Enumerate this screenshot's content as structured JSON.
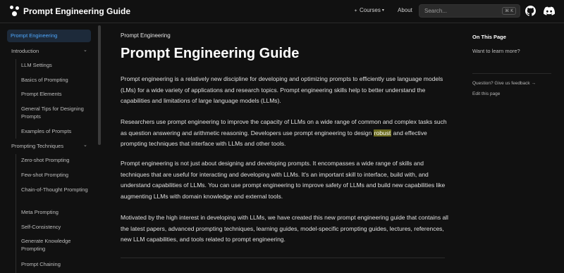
{
  "navbar": {
    "brand": "Prompt Engineering Guide",
    "courses": "Courses",
    "about": "About",
    "search_placeholder": "Search...",
    "search_shortcut": "⌘ K"
  },
  "sidebar": {
    "active": "Prompt Engineering",
    "introduction": "Introduction",
    "intro_items": [
      "LLM Settings",
      "Basics of Prompting",
      "Prompt Elements",
      "General Tips for Designing Prompts",
      "Examples of Prompts"
    ],
    "techniques": "Prompting Techniques",
    "technique_items": [
      "Zero-shot Prompting",
      "Few-shot Prompting",
      "Chain-of-Thought Prompting",
      "Meta Prompting",
      "Self-Consistency",
      "Generate Knowledge Prompting",
      "Prompt Chaining"
    ]
  },
  "main": {
    "breadcrumb": "Prompt Engineering",
    "title": "Prompt Engineering Guide",
    "p1": "Prompt engineering is a relatively new discipline for developing and optimizing prompts to efficiently use language models (LMs) for a wide variety of applications and research topics. Prompt engineering skills help to better understand the capabilities and limitations of large language models (LLMs).",
    "p2_before": "Researchers use prompt engineering to improve the capacity of LLMs on a wide range of common and complex tasks such as question answering and arithmetic reasoning. Developers use prompt engineering to design ",
    "p2_highlight": "robust",
    "p2_after": " and effective prompting techniques that interface with LLMs and other tools.",
    "p3": "Prompt engineering is not just about designing and developing prompts. It encompasses a wide range of skills and techniques that are useful for interacting and developing with LLMs. It's an important skill to interface, build with, and understand capabilities of LLMs. You can use prompt engineering to improve safety of LLMs and build new capabilities like augmenting LLMs with domain knowledge and external tools.",
    "p4": "Motivated by the high interest in developing with LLMs, we have created this new prompt engineering guide that contains all the latest papers, advanced prompting techniques, learning guides, model-specific prompting guides, lectures, references, new LLM capabilities, and tools related to prompt engineering."
  },
  "toc": {
    "heading": "On This Page",
    "link": "Want to learn more?",
    "feedback": "Question? Give us feedback →",
    "edit": "Edit this page"
  },
  "colors": {
    "background": "#111111",
    "active_link": "#4ea8ff",
    "highlight": "#6b6b1e"
  }
}
